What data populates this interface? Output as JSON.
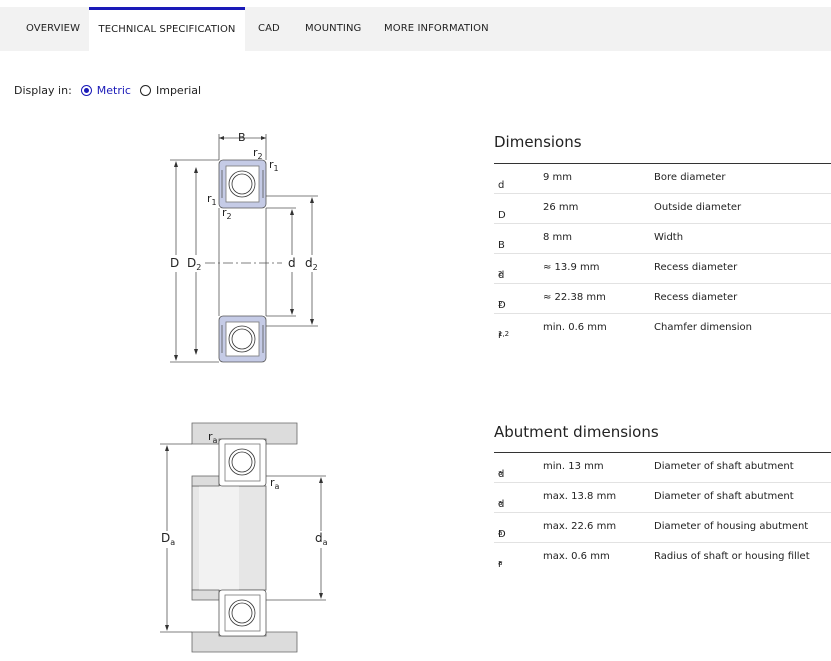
{
  "tabs": [
    {
      "label": "OVERVIEW",
      "active": false
    },
    {
      "label": "TECHNICAL SPECIFICATION",
      "active": true
    },
    {
      "label": "CAD",
      "active": false
    },
    {
      "label": "MOUNTING",
      "active": false
    },
    {
      "label": "MORE INFORMATION",
      "active": false
    }
  ],
  "display": {
    "label": "Display in:",
    "metric": "Metric",
    "imperial": "Imperial",
    "selected": "Metric"
  },
  "dimensions": {
    "title": "Dimensions",
    "rows": [
      {
        "sym": "d",
        "sub": "",
        "value": "9 mm",
        "desc": "Bore diameter"
      },
      {
        "sym": "D",
        "sub": "",
        "value": "26 mm",
        "desc": "Outside diameter"
      },
      {
        "sym": "B",
        "sub": "",
        "value": "8 mm",
        "desc": "Width"
      },
      {
        "sym": "d",
        "sub": "2",
        "value": "≈ 13.9 mm",
        "desc": "Recess diameter"
      },
      {
        "sym": "D",
        "sub": "2",
        "value": "≈ 22.38 mm",
        "desc": "Recess diameter"
      },
      {
        "sym": "r",
        "sub": "1,2",
        "value": "min. 0.6 mm",
        "desc": "Chamfer dimension"
      }
    ]
  },
  "abutment": {
    "title": "Abutment dimensions",
    "rows": [
      {
        "sym": "d",
        "sub": "a",
        "value": "min. 13 mm",
        "desc": "Diameter of shaft abutment"
      },
      {
        "sym": "d",
        "sub": "a",
        "value": "max. 13.8 mm",
        "desc": "Diameter of shaft abutment"
      },
      {
        "sym": "D",
        "sub": "a",
        "value": "max. 22.6 mm",
        "desc": "Diameter of housing abutment"
      },
      {
        "sym": "r",
        "sub": "a",
        "value": "max. 0.6 mm",
        "desc": "Radius of shaft or housing fillet"
      }
    ]
  },
  "diagram1": {
    "B": "B",
    "r": "r",
    "sub1": "1",
    "sub2": "2",
    "D": "D",
    "d": "d"
  },
  "diagram2": {
    "r": "r",
    "a": "a",
    "D": "D",
    "d": "d"
  },
  "colors": {
    "accent": "#1a1ab8",
    "bearing_fill": "#c5cbe6",
    "housing_fill": "#dcdcdc"
  }
}
